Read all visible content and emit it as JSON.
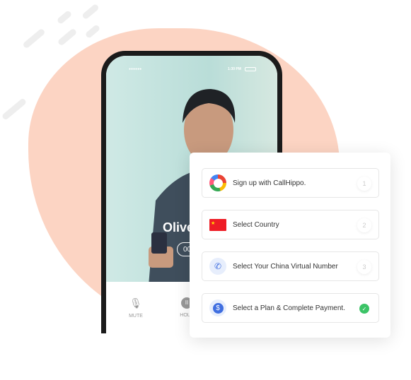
{
  "phone": {
    "time": "1:30 PM",
    "caller_name": "Olive",
    "timer": "00",
    "controls": [
      {
        "label": "MUTE",
        "icon": "mic-off-icon"
      },
      {
        "label": "HOLD",
        "icon": "pause-icon"
      }
    ]
  },
  "steps": [
    {
      "label": "Sign up with CallHippo.",
      "number": "1",
      "icon": "callhippo-logo-icon"
    },
    {
      "label": "Select Country",
      "number": "2",
      "icon": "china-flag-icon"
    },
    {
      "label": "Select Your China Virtual Number",
      "number": "3",
      "icon": "phone-icon"
    },
    {
      "label": "Select a Plan & Complete Payment.",
      "status": "complete",
      "icon": "dollar-icon"
    }
  ],
  "colors": {
    "blob": "#fcd4c3",
    "check": "#3cc467",
    "accent": "#3f6ee0"
  }
}
